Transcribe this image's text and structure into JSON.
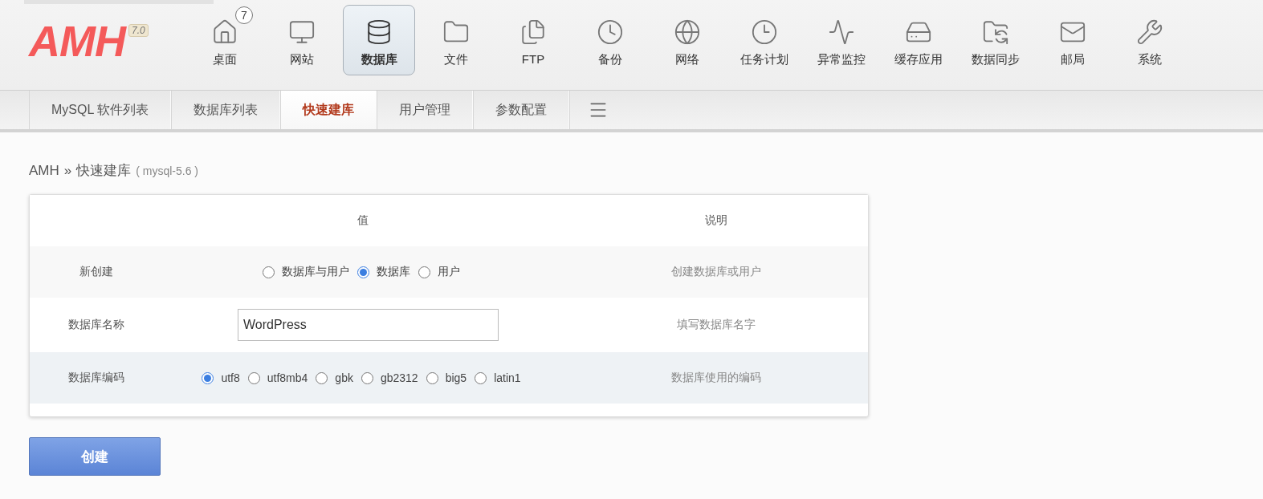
{
  "logo": {
    "text": "AMH",
    "version": "7.0"
  },
  "nav": [
    {
      "label": "桌面",
      "badge": "7",
      "selected": false
    },
    {
      "label": "网站",
      "selected": false
    },
    {
      "label": "数据库",
      "selected": true
    },
    {
      "label": "文件",
      "selected": false
    },
    {
      "label": "FTP",
      "selected": false
    },
    {
      "label": "备份",
      "selected": false
    },
    {
      "label": "网络",
      "selected": false
    },
    {
      "label": "任务计划",
      "selected": false
    },
    {
      "label": "异常监控",
      "selected": false
    },
    {
      "label": "缓存应用",
      "selected": false
    },
    {
      "label": "数据同步",
      "selected": false
    },
    {
      "label": "邮局",
      "selected": false
    },
    {
      "label": "系统",
      "selected": false
    }
  ],
  "subnav": [
    {
      "label": "MySQL 软件列表",
      "selected": false
    },
    {
      "label": "数据库列表",
      "selected": false
    },
    {
      "label": "快速建库",
      "selected": true
    },
    {
      "label": "用户管理",
      "selected": false
    },
    {
      "label": "参数配置",
      "selected": false
    }
  ],
  "breadcrumb": {
    "root": "AMH",
    "separator": "»",
    "page": "快速建库",
    "detail": "( mysql-5.6 )"
  },
  "form": {
    "columns": [
      "值",
      "说明"
    ],
    "rows": [
      {
        "kind": "radio",
        "label": "新创建",
        "options": [
          {
            "label": "数据库与用户",
            "selected": false
          },
          {
            "label": "数据库",
            "selected": true
          },
          {
            "label": "用户",
            "selected": false
          }
        ],
        "description": "创建数据库或用户"
      },
      {
        "kind": "text",
        "label": "数据库名称",
        "value": "WordPress",
        "description": "填写数据库名字"
      },
      {
        "kind": "radio",
        "label": "数据库编码",
        "options": [
          {
            "label": "utf8",
            "selected": true
          },
          {
            "label": "utf8mb4",
            "selected": false
          },
          {
            "label": "gbk",
            "selected": false
          },
          {
            "label": "gb2312",
            "selected": false
          },
          {
            "label": "big5",
            "selected": false
          },
          {
            "label": "latin1",
            "selected": false
          }
        ],
        "description": "数据库使用的编码"
      }
    ]
  },
  "submit": "创建"
}
